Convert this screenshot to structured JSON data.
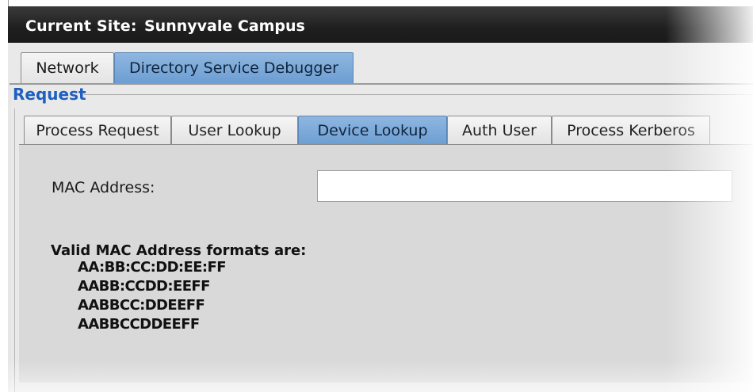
{
  "header": {
    "label": "Current Site:",
    "site_name": "Sunnyvale Campus"
  },
  "top_tabs": [
    {
      "label": "Network",
      "active": false
    },
    {
      "label": "Directory Service Debugger",
      "active": true
    }
  ],
  "section": {
    "title": "Request"
  },
  "request_tabs": [
    {
      "label": "Process Request",
      "active": false
    },
    {
      "label": "User Lookup",
      "active": false
    },
    {
      "label": "Device Lookup",
      "active": true
    },
    {
      "label": "Auth User",
      "active": false
    },
    {
      "label": "Process Kerberos",
      "active": false
    }
  ],
  "form": {
    "mac_label": "MAC Address:",
    "mac_value": "",
    "formats_title": "Valid MAC Address formats are:",
    "formats": [
      "AA:BB:CC:DD:EE:FF",
      "AABB:CCDD:EEFF",
      "AABBCC:DDEEFF",
      "AABBCCDDEEFF"
    ]
  },
  "colors": {
    "accent_tab": "#7aa6d6",
    "section_title": "#1e5fbf",
    "title_bar": "#1f1f1f"
  }
}
